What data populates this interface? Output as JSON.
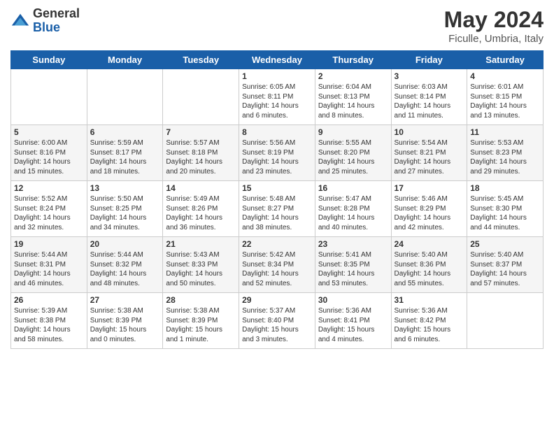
{
  "header": {
    "logo_general": "General",
    "logo_blue": "Blue",
    "title": "May 2024",
    "subtitle": "Ficulle, Umbria, Italy"
  },
  "days_of_week": [
    "Sunday",
    "Monday",
    "Tuesday",
    "Wednesday",
    "Thursday",
    "Friday",
    "Saturday"
  ],
  "weeks": [
    [
      {
        "day": "",
        "content": ""
      },
      {
        "day": "",
        "content": ""
      },
      {
        "day": "",
        "content": ""
      },
      {
        "day": "1",
        "content": "Sunrise: 6:05 AM\nSunset: 8:11 PM\nDaylight: 14 hours\nand 6 minutes."
      },
      {
        "day": "2",
        "content": "Sunrise: 6:04 AM\nSunset: 8:13 PM\nDaylight: 14 hours\nand 8 minutes."
      },
      {
        "day": "3",
        "content": "Sunrise: 6:03 AM\nSunset: 8:14 PM\nDaylight: 14 hours\nand 11 minutes."
      },
      {
        "day": "4",
        "content": "Sunrise: 6:01 AM\nSunset: 8:15 PM\nDaylight: 14 hours\nand 13 minutes."
      }
    ],
    [
      {
        "day": "5",
        "content": "Sunrise: 6:00 AM\nSunset: 8:16 PM\nDaylight: 14 hours\nand 15 minutes."
      },
      {
        "day": "6",
        "content": "Sunrise: 5:59 AM\nSunset: 8:17 PM\nDaylight: 14 hours\nand 18 minutes."
      },
      {
        "day": "7",
        "content": "Sunrise: 5:57 AM\nSunset: 8:18 PM\nDaylight: 14 hours\nand 20 minutes."
      },
      {
        "day": "8",
        "content": "Sunrise: 5:56 AM\nSunset: 8:19 PM\nDaylight: 14 hours\nand 23 minutes."
      },
      {
        "day": "9",
        "content": "Sunrise: 5:55 AM\nSunset: 8:20 PM\nDaylight: 14 hours\nand 25 minutes."
      },
      {
        "day": "10",
        "content": "Sunrise: 5:54 AM\nSunset: 8:21 PM\nDaylight: 14 hours\nand 27 minutes."
      },
      {
        "day": "11",
        "content": "Sunrise: 5:53 AM\nSunset: 8:23 PM\nDaylight: 14 hours\nand 29 minutes."
      }
    ],
    [
      {
        "day": "12",
        "content": "Sunrise: 5:52 AM\nSunset: 8:24 PM\nDaylight: 14 hours\nand 32 minutes."
      },
      {
        "day": "13",
        "content": "Sunrise: 5:50 AM\nSunset: 8:25 PM\nDaylight: 14 hours\nand 34 minutes."
      },
      {
        "day": "14",
        "content": "Sunrise: 5:49 AM\nSunset: 8:26 PM\nDaylight: 14 hours\nand 36 minutes."
      },
      {
        "day": "15",
        "content": "Sunrise: 5:48 AM\nSunset: 8:27 PM\nDaylight: 14 hours\nand 38 minutes."
      },
      {
        "day": "16",
        "content": "Sunrise: 5:47 AM\nSunset: 8:28 PM\nDaylight: 14 hours\nand 40 minutes."
      },
      {
        "day": "17",
        "content": "Sunrise: 5:46 AM\nSunset: 8:29 PM\nDaylight: 14 hours\nand 42 minutes."
      },
      {
        "day": "18",
        "content": "Sunrise: 5:45 AM\nSunset: 8:30 PM\nDaylight: 14 hours\nand 44 minutes."
      }
    ],
    [
      {
        "day": "19",
        "content": "Sunrise: 5:44 AM\nSunset: 8:31 PM\nDaylight: 14 hours\nand 46 minutes."
      },
      {
        "day": "20",
        "content": "Sunrise: 5:44 AM\nSunset: 8:32 PM\nDaylight: 14 hours\nand 48 minutes."
      },
      {
        "day": "21",
        "content": "Sunrise: 5:43 AM\nSunset: 8:33 PM\nDaylight: 14 hours\nand 50 minutes."
      },
      {
        "day": "22",
        "content": "Sunrise: 5:42 AM\nSunset: 8:34 PM\nDaylight: 14 hours\nand 52 minutes."
      },
      {
        "day": "23",
        "content": "Sunrise: 5:41 AM\nSunset: 8:35 PM\nDaylight: 14 hours\nand 53 minutes."
      },
      {
        "day": "24",
        "content": "Sunrise: 5:40 AM\nSunset: 8:36 PM\nDaylight: 14 hours\nand 55 minutes."
      },
      {
        "day": "25",
        "content": "Sunrise: 5:40 AM\nSunset: 8:37 PM\nDaylight: 14 hours\nand 57 minutes."
      }
    ],
    [
      {
        "day": "26",
        "content": "Sunrise: 5:39 AM\nSunset: 8:38 PM\nDaylight: 14 hours\nand 58 minutes."
      },
      {
        "day": "27",
        "content": "Sunrise: 5:38 AM\nSunset: 8:39 PM\nDaylight: 15 hours\nand 0 minutes."
      },
      {
        "day": "28",
        "content": "Sunrise: 5:38 AM\nSunset: 8:39 PM\nDaylight: 15 hours\nand 1 minute."
      },
      {
        "day": "29",
        "content": "Sunrise: 5:37 AM\nSunset: 8:40 PM\nDaylight: 15 hours\nand 3 minutes."
      },
      {
        "day": "30",
        "content": "Sunrise: 5:36 AM\nSunset: 8:41 PM\nDaylight: 15 hours\nand 4 minutes."
      },
      {
        "day": "31",
        "content": "Sunrise: 5:36 AM\nSunset: 8:42 PM\nDaylight: 15 hours\nand 6 minutes."
      },
      {
        "day": "",
        "content": ""
      }
    ]
  ]
}
